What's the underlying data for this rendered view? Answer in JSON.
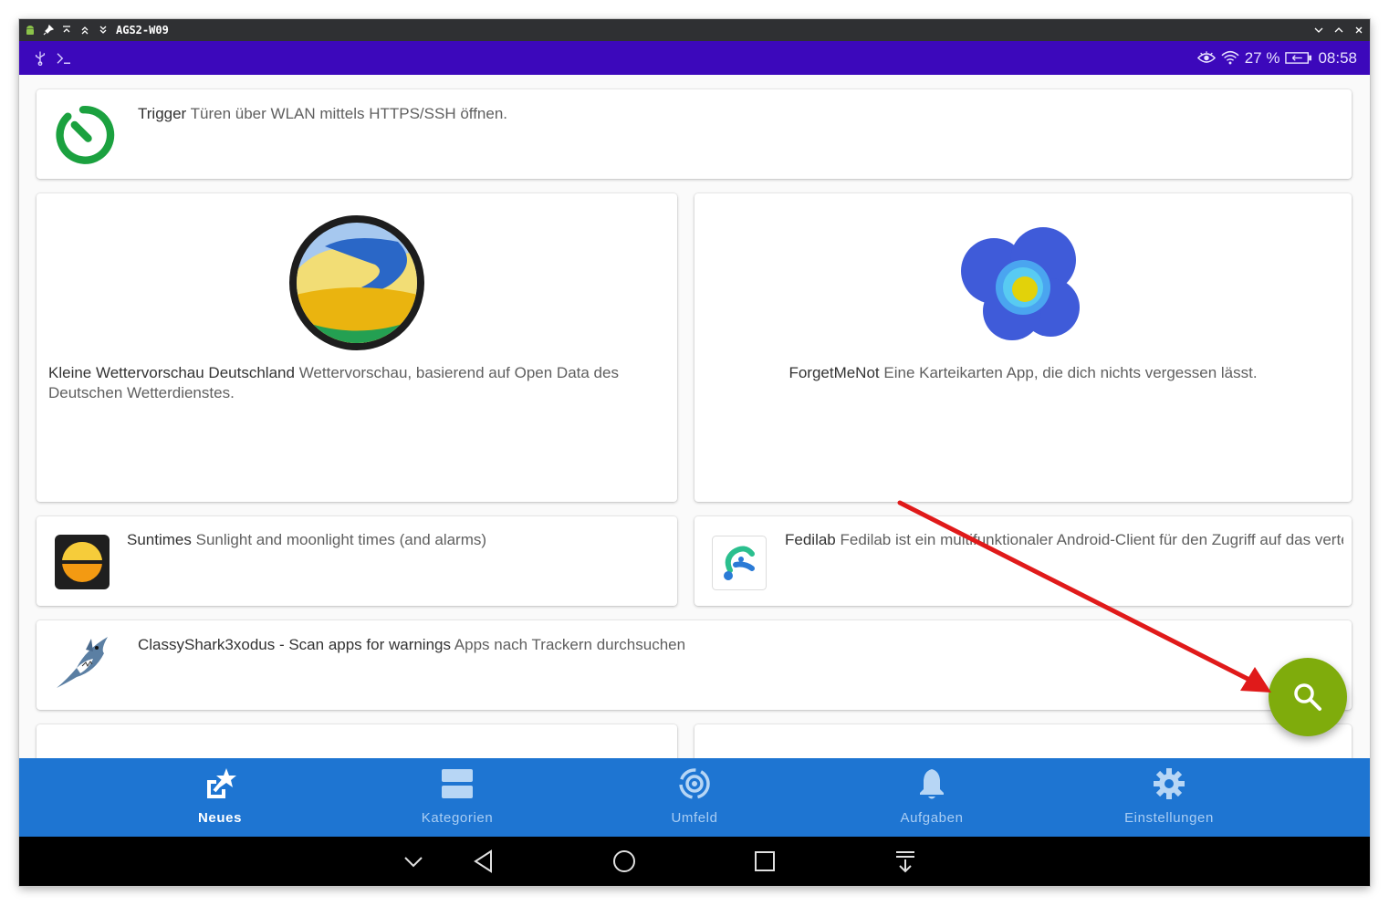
{
  "window": {
    "title": "AGS2-W09"
  },
  "status_bar": {
    "battery": "27 %",
    "time": "08:58"
  },
  "cards": [
    {
      "name": "Trigger",
      "summary": "Türen über WLAN mittels HTTPS/SSH öffnen."
    },
    {
      "name": "Kleine Wettervorschau Deutschland",
      "summary": "Wettervorschau, basierend auf Open Data des Deutschen Wetterdienstes."
    },
    {
      "name": "ForgetMeNot",
      "summary": "Eine Karteikarten App, die dich nichts vergessen lässt."
    },
    {
      "name": "Suntimes",
      "summary": "Sunlight and moonlight times (and alarms)"
    },
    {
      "name": "Fedilab",
      "summary": "Fedilab ist ein multifunktionaler Android-Client für den Zugriff auf das verteil"
    },
    {
      "name": "ClassyShark3xodus - Scan apps for warnings",
      "summary": "Apps nach Trackern durchsuchen"
    }
  ],
  "bottom_nav": [
    {
      "label": "Neues",
      "icon": "star-share-icon",
      "active": true
    },
    {
      "label": "Kategorien",
      "icon": "categories-icon",
      "active": false
    },
    {
      "label": "Umfeld",
      "icon": "nearby-icon",
      "active": false
    },
    {
      "label": "Aufgaben",
      "icon": "bell-icon",
      "active": false
    },
    {
      "label": "Einstellungen",
      "icon": "gear-icon",
      "active": false
    }
  ],
  "colors": {
    "status_bar": "#3c08bb",
    "bottom_nav": "#1e75d2",
    "fab": "#7fac0c",
    "annotation_arrow": "#e01a1a"
  }
}
